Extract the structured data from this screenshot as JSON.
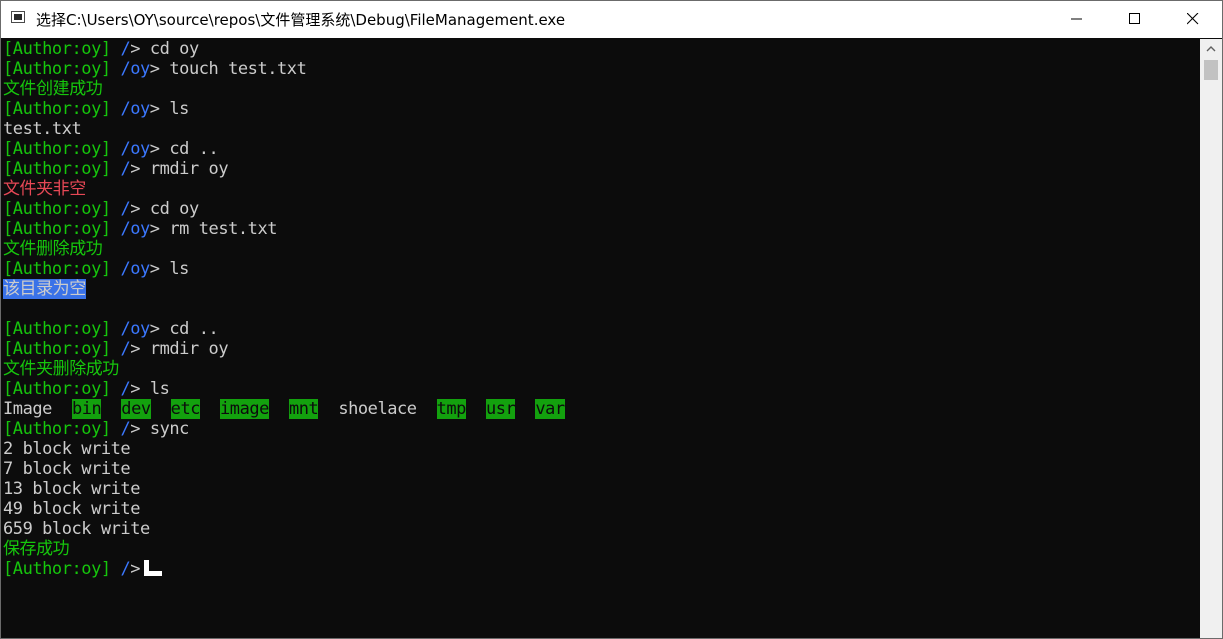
{
  "window": {
    "title": "选择C:\\Users\\OY\\source\\repos\\文件管理系统\\Debug\\FileManagement.exe"
  },
  "console": {
    "lines": [
      {
        "type": "prompt",
        "user": "[Author:oy]",
        "path": "/",
        "cmd": "cd oy"
      },
      {
        "type": "prompt",
        "user": "[Author:oy]",
        "path": "/oy",
        "cmd": "touch test.txt"
      },
      {
        "type": "output",
        "color": "green",
        "text": "文件创建成功"
      },
      {
        "type": "prompt",
        "user": "[Author:oy]",
        "path": "/oy",
        "cmd": "ls"
      },
      {
        "type": "output",
        "color": "white",
        "text": "test.txt"
      },
      {
        "type": "prompt",
        "user": "[Author:oy]",
        "path": "/oy",
        "cmd": "cd .."
      },
      {
        "type": "prompt",
        "user": "[Author:oy]",
        "path": "/",
        "cmd": "rmdir oy"
      },
      {
        "type": "output",
        "color": "red",
        "text": "文件夹非空"
      },
      {
        "type": "prompt",
        "user": "[Author:oy]",
        "path": "/",
        "cmd": "cd oy"
      },
      {
        "type": "prompt",
        "user": "[Author:oy]",
        "path": "/oy",
        "cmd": "rm test.txt"
      },
      {
        "type": "output",
        "color": "green",
        "text": "文件删除成功"
      },
      {
        "type": "prompt",
        "user": "[Author:oy]",
        "path": "/oy",
        "cmd": "ls"
      },
      {
        "type": "selected",
        "text": "该目录为空"
      },
      {
        "type": "blank"
      },
      {
        "type": "prompt",
        "user": "[Author:oy]",
        "path": "/oy",
        "cmd": "cd .."
      },
      {
        "type": "prompt",
        "user": "[Author:oy]",
        "path": "/",
        "cmd": "rmdir oy"
      },
      {
        "type": "output",
        "color": "green",
        "text": "文件夹删除成功"
      },
      {
        "type": "prompt",
        "user": "[Author:oy]",
        "path": "/",
        "cmd": "ls"
      },
      {
        "type": "ls",
        "items": [
          {
            "name": "Image",
            "dir": false
          },
          {
            "name": "bin",
            "dir": true
          },
          {
            "name": "dev",
            "dir": true
          },
          {
            "name": "etc",
            "dir": true
          },
          {
            "name": "image",
            "dir": true
          },
          {
            "name": "mnt",
            "dir": true
          },
          {
            "name": "shoelace",
            "dir": false
          },
          {
            "name": "tmp",
            "dir": true
          },
          {
            "name": "usr",
            "dir": true
          },
          {
            "name": "var",
            "dir": true
          }
        ]
      },
      {
        "type": "prompt",
        "user": "[Author:oy]",
        "path": "/",
        "cmd": "sync"
      },
      {
        "type": "output",
        "color": "white",
        "text": "2 block write"
      },
      {
        "type": "output",
        "color": "white",
        "text": "7 block write"
      },
      {
        "type": "output",
        "color": "white",
        "text": "13 block write"
      },
      {
        "type": "output",
        "color": "white",
        "text": "49 block write"
      },
      {
        "type": "output",
        "color": "white",
        "text": "659 block write"
      },
      {
        "type": "output",
        "color": "green",
        "text": "保存成功"
      },
      {
        "type": "current",
        "user": "[Author:oy]",
        "path": "/"
      }
    ],
    "prompt_symbol": ">"
  },
  "colors": {
    "background": "#0c0c0c",
    "prompt_user": "#16c60c",
    "path": "#3b78ff",
    "error": "#e74856",
    "text": "#cccccc",
    "dir_highlight": "#13a10e",
    "selection": "#3a72e8"
  },
  "icons": {
    "app": "console-app-icon",
    "minimize": "minimize-icon",
    "maximize": "maximize-icon",
    "close": "close-icon",
    "scroll_up": "scroll-up-arrow-icon"
  }
}
